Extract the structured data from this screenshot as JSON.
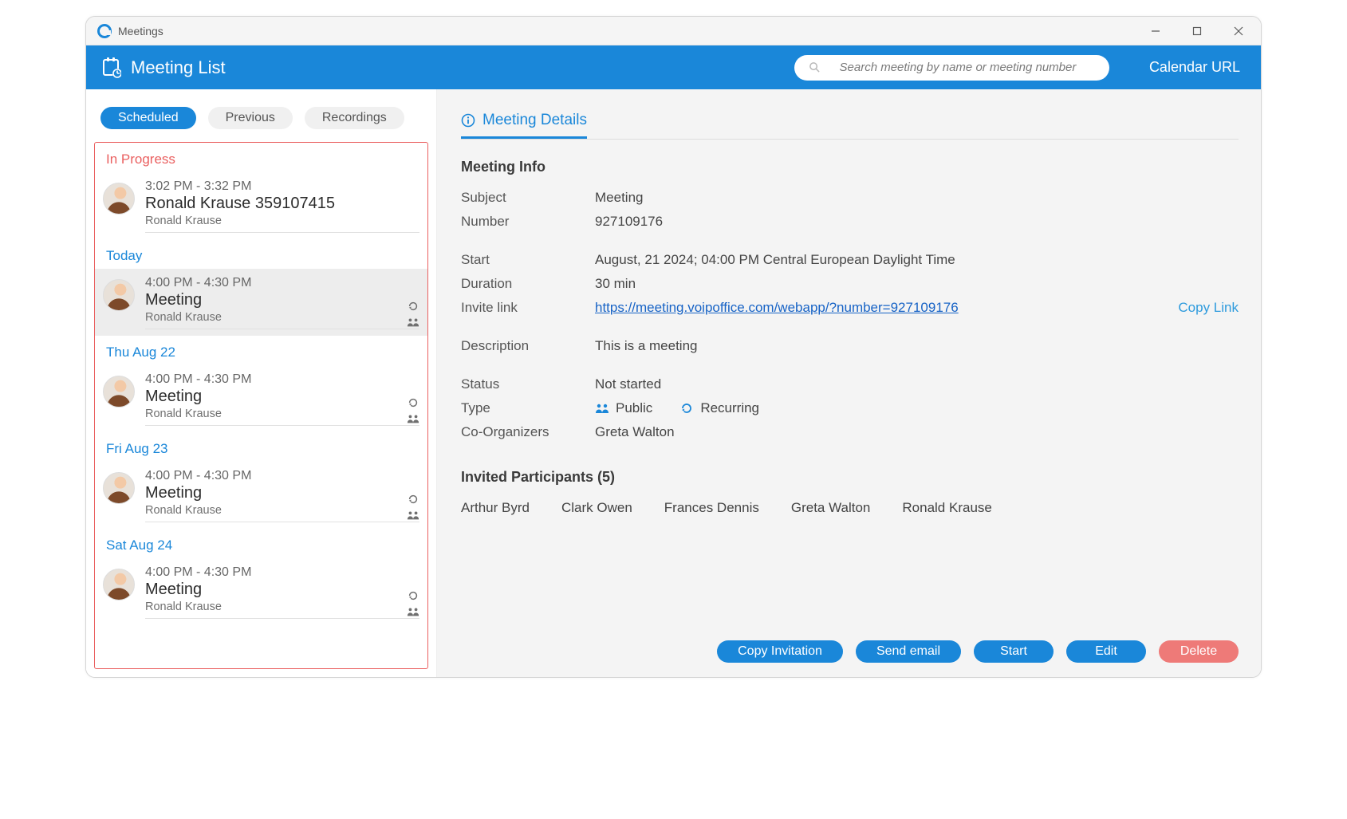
{
  "window": {
    "title": "Meetings"
  },
  "header": {
    "title": "Meeting List",
    "search_placeholder": "Search meeting by name or meeting number",
    "calendar_url_label": "Calendar URL"
  },
  "tabs": {
    "scheduled": "Scheduled",
    "previous": "Previous",
    "recordings": "Recordings"
  },
  "list": {
    "sections": [
      {
        "label": "In Progress",
        "kind": "in-progress",
        "items": [
          {
            "time": "3:02 PM - 3:32 PM",
            "title": "Ronald Krause 359107415",
            "organizer": "Ronald Krause",
            "icons": false,
            "selected": false
          }
        ]
      },
      {
        "label": "Today",
        "kind": "date",
        "items": [
          {
            "time": "4:00 PM - 4:30 PM",
            "title": "Meeting",
            "organizer": "Ronald Krause",
            "icons": true,
            "selected": true
          }
        ]
      },
      {
        "label": "Thu Aug 22",
        "kind": "date",
        "items": [
          {
            "time": "4:00 PM - 4:30 PM",
            "title": "Meeting",
            "organizer": "Ronald Krause",
            "icons": true,
            "selected": false
          }
        ]
      },
      {
        "label": "Fri Aug 23",
        "kind": "date",
        "items": [
          {
            "time": "4:00 PM - 4:30 PM",
            "title": "Meeting",
            "organizer": "Ronald Krause",
            "icons": true,
            "selected": false
          }
        ]
      },
      {
        "label": "Sat Aug 24",
        "kind": "date",
        "items": [
          {
            "time": "4:00 PM - 4:30 PM",
            "title": "Meeting",
            "organizer": "Ronald Krause",
            "icons": true,
            "selected": false
          }
        ]
      }
    ]
  },
  "details": {
    "tab_label": "Meeting Details",
    "info_label": "Meeting Info",
    "labels": {
      "subject": "Subject",
      "number": "Number",
      "start": "Start",
      "duration": "Duration",
      "invite_link": "Invite link",
      "description": "Description",
      "status": "Status",
      "type": "Type",
      "co_organizers": "Co-Organizers"
    },
    "values": {
      "subject": "Meeting",
      "number": "927109176",
      "start": "August, 21 2024; 04:00 PM Central European Daylight Time",
      "duration": "30 min",
      "invite_link": "https://meeting.voipoffice.com/webapp/?number=927109176",
      "description": "This is a meeting",
      "status": "Not started",
      "type_public": "Public",
      "type_recurring": "Recurring",
      "co_organizers": "Greta Walton"
    },
    "copy_link_label": "Copy Link",
    "participants_label": "Invited Participants (5)",
    "participants": [
      "Arthur Byrd",
      "Clark Owen",
      "Frances Dennis",
      "Greta Walton",
      "Ronald Krause"
    ]
  },
  "buttons": {
    "copy_invitation": "Copy Invitation",
    "send_email": "Send email",
    "start": "Start",
    "edit": "Edit",
    "delete": "Delete"
  }
}
